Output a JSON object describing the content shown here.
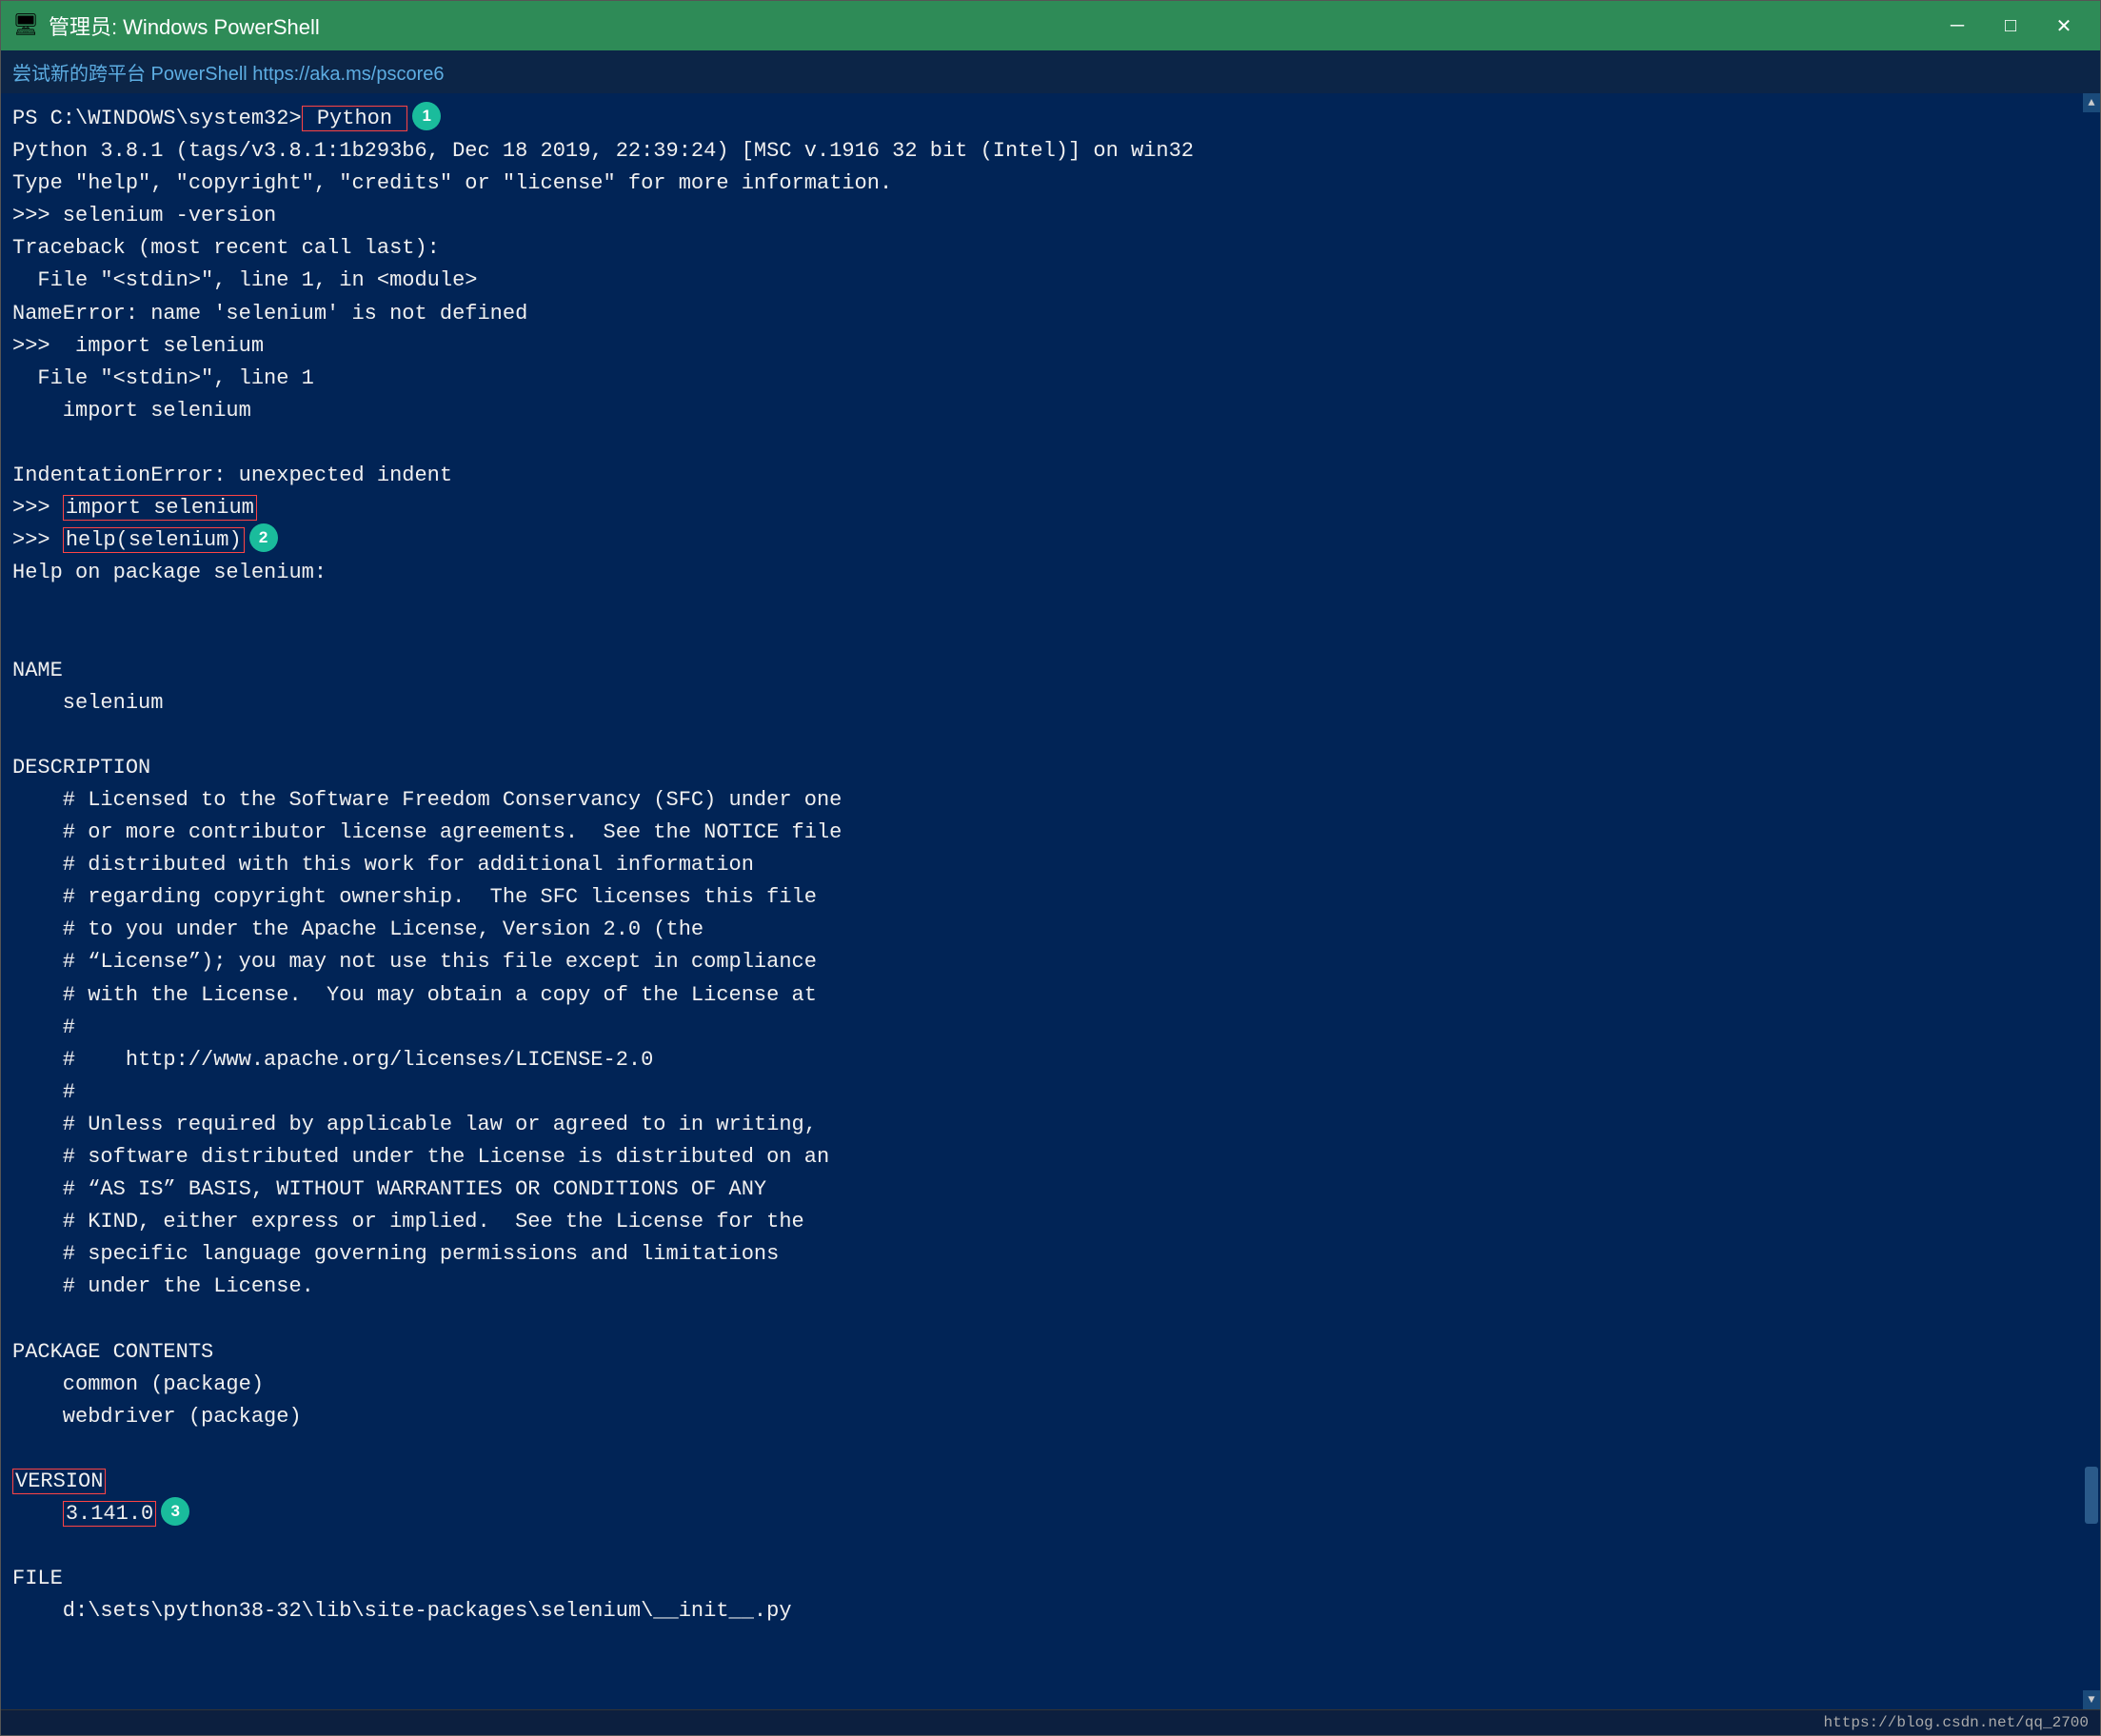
{
  "titleBar": {
    "icon": "🖥",
    "text": "管理员: Windows PowerShell",
    "minimizeLabel": "─",
    "maximizeLabel": "□",
    "closeLabel": "✕"
  },
  "toolbar": {
    "hint": "尝试新的跨平台 PowerShell https://aka.ms/pscore6"
  },
  "terminal": {
    "lines": [
      {
        "id": "line1",
        "text": "PS C:\\WINDOWS\\system32>"
      },
      {
        "id": "line2",
        "text": "Python 3.8.1 (tags/v3.8.1:1b293b6, Dec 18 2019, 22:39:24) [MSC v.1916 32 bit (Intel)] on win32"
      },
      {
        "id": "line3",
        "text": "Type \"help\", \"copyright\", \"credits\" or \"license\" for more information."
      },
      {
        "id": "line4",
        "text": ">>> selenium -version"
      },
      {
        "id": "line5",
        "text": "Traceback (most recent call last):"
      },
      {
        "id": "line6",
        "text": "  File \"<stdin>\", line 1, in <module>"
      },
      {
        "id": "line7",
        "text": "NameError: name 'selenium' is not defined"
      },
      {
        "id": "line8",
        "text": ">>>  import selenium"
      },
      {
        "id": "line9",
        "text": "  File \"<stdin>\", line 1"
      },
      {
        "id": "line10",
        "text": "    import selenium"
      },
      {
        "id": "line11",
        "text": ""
      },
      {
        "id": "line12",
        "text": "IndentationError: unexpected indent"
      },
      {
        "id": "line13",
        "text": ">>> "
      },
      {
        "id": "line14",
        "text": ">>> "
      },
      {
        "id": "line15",
        "text": "Help on package selenium:"
      },
      {
        "id": "line16",
        "text": ""
      },
      {
        "id": "line17",
        "text": ""
      },
      {
        "id": "line18",
        "text": "NAME"
      },
      {
        "id": "line19",
        "text": "    selenium"
      },
      {
        "id": "line20",
        "text": ""
      },
      {
        "id": "line21",
        "text": "DESCRIPTION"
      },
      {
        "id": "line22",
        "text": "    # Licensed to the Software Freedom Conservancy (SFC) under one"
      },
      {
        "id": "line23",
        "text": "    # or more contributor license agreements.  See the NOTICE file"
      },
      {
        "id": "line24",
        "text": "    # distributed with this work for additional information"
      },
      {
        "id": "line25",
        "text": "    # regarding copyright ownership.  The SFC licenses this file"
      },
      {
        "id": "line26",
        "text": "    # to you under the Apache License, Version 2.0 (the"
      },
      {
        "id": "line27",
        "text": "    # “License”); you may not use this file except in compliance"
      },
      {
        "id": "line28",
        "text": "    # with the License.  You may obtain a copy of the License at"
      },
      {
        "id": "line29",
        "text": "    #"
      },
      {
        "id": "line30",
        "text": "    #    http://www.apache.org/licenses/LICENSE-2.0"
      },
      {
        "id": "line31",
        "text": "    #"
      },
      {
        "id": "line32",
        "text": "    # Unless required by applicable law or agreed to in writing,"
      },
      {
        "id": "line33",
        "text": "    # software distributed under the License is distributed on an"
      },
      {
        "id": "line34",
        "text": "    # “AS IS” BASIS, WITHOUT WARRANTIES OR CONDITIONS OF ANY"
      },
      {
        "id": "line35",
        "text": "    # KIND, either express or implied.  See the License for the"
      },
      {
        "id": "line36",
        "text": "    # specific language governing permissions and limitations"
      },
      {
        "id": "line37",
        "text": "    # under the License."
      },
      {
        "id": "line38",
        "text": ""
      },
      {
        "id": "line39",
        "text": "PACKAGE CONTENTS"
      },
      {
        "id": "line40",
        "text": "    common (package)"
      },
      {
        "id": "line41",
        "text": "    webdriver (package)"
      },
      {
        "id": "line42",
        "text": ""
      },
      {
        "id": "line43",
        "text": "VERSION"
      },
      {
        "id": "line44",
        "text": "    3.141.0"
      },
      {
        "id": "line45",
        "text": ""
      },
      {
        "id": "line46",
        "text": "FILE"
      },
      {
        "id": "line47",
        "text": "    d:\\sets\\python38-32\\lib\\site-packages\\selenium\\__init__.py"
      }
    ]
  },
  "statusBar": {
    "url": "https://blog.csdn.net/qq_2700"
  },
  "badges": {
    "badge1": "1",
    "badge2": "2",
    "badge3": "3"
  }
}
